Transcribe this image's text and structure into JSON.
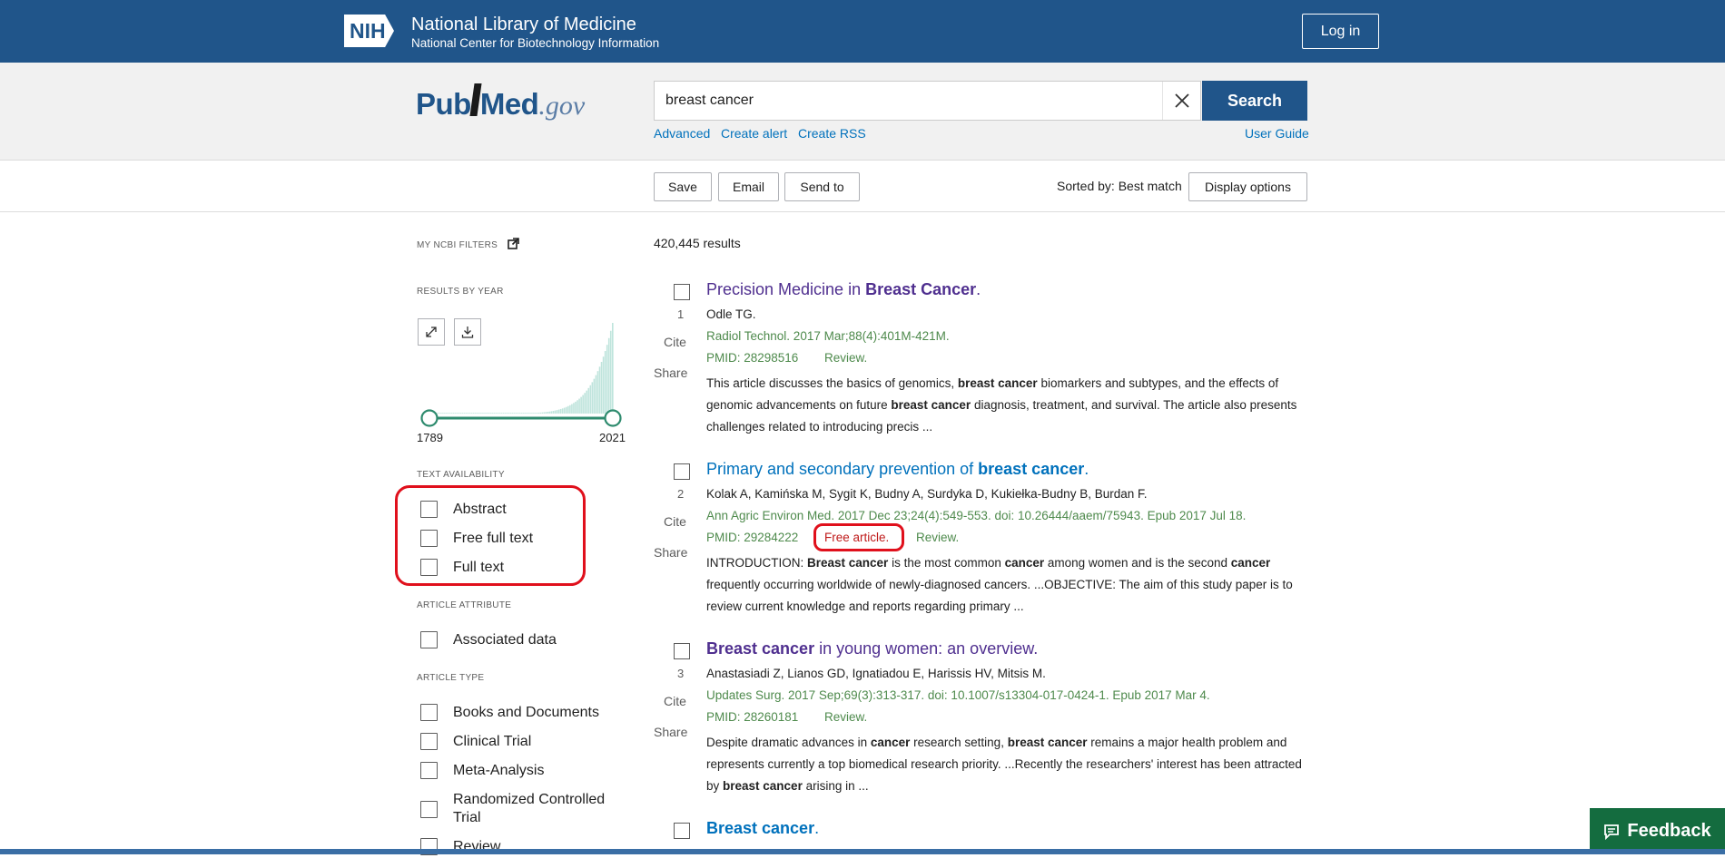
{
  "nih": {
    "logo_text": "NIH",
    "title": "National Library of Medicine",
    "subtitle": "National Center for Biotechnology Information",
    "login_label": "Log in"
  },
  "brand": {
    "pub": "Pub",
    "med": "Med",
    "gov": ".gov"
  },
  "search": {
    "value": "breast cancer",
    "button_label": "Search",
    "links": {
      "advanced": "Advanced",
      "create_alert": "Create alert",
      "create_rss": "Create RSS",
      "user_guide": "User Guide"
    }
  },
  "toolbar": {
    "save": "Save",
    "email": "Email",
    "send_to": "Send to",
    "sorted_by": "Sorted by: Best match",
    "display_options": "Display options"
  },
  "sidebar": {
    "my_filters": "MY NCBI FILTERS",
    "results_by_year": "RESULTS BY YEAR",
    "year_start": "1789",
    "year_end": "2021",
    "text_availability": {
      "heading": "TEXT AVAILABILITY",
      "items": [
        "Abstract",
        "Free full text",
        "Full text"
      ]
    },
    "article_attribute": {
      "heading": "ARTICLE ATTRIBUTE",
      "items": [
        "Associated data"
      ]
    },
    "article_type": {
      "heading": "ARTICLE TYPE",
      "items": [
        "Books and Documents",
        "Clinical Trial",
        "Meta-Analysis",
        "Randomized Controlled Trial",
        "Review"
      ]
    }
  },
  "results": {
    "count": "420,445 results",
    "cite_label": "Cite",
    "share_label": "Share",
    "items": [
      {
        "num": "1",
        "title_plain": "Precision Medicine in ",
        "title_bold": "Breast Cancer",
        "title_end": ".",
        "authors": "Odle TG.",
        "journal": "Radiol Technol. 2017 Mar;88(4):401M-421M.",
        "pmid": "PMID: 28298516",
        "review": "Review.",
        "snippet": [
          {
            "t": "This article discusses the basics of genomics, "
          },
          {
            "t": "breast cancer",
            "b": true
          },
          {
            "t": " biomarkers and subtypes, and the effects of genomic advancements on future "
          },
          {
            "t": "breast cancer",
            "b": true
          },
          {
            "t": " diagnosis, treatment, and survival. The article also presents challenges related to introducing precis ..."
          }
        ]
      },
      {
        "num": "2",
        "title_plain": "Primary and secondary prevention of ",
        "title_bold": "breast cancer",
        "title_end": ".",
        "authors": "Kolak A, Kamińska M, Sygit K, Budny A, Surdyka D, Kukiełka-Budny B, Burdan F.",
        "journal": "Ann Agric Environ Med. 2017 Dec 23;24(4):549-553. doi: 10.26444/aaem/75943. Epub 2017 Jul 18.",
        "pmid": "PMID: 29284222",
        "free": "Free article.",
        "review": "Review.",
        "snippet": [
          {
            "t": "INTRODUCTION: "
          },
          {
            "t": "Breast cancer",
            "b": true
          },
          {
            "t": " is the most common "
          },
          {
            "t": "cancer",
            "b": true
          },
          {
            "t": " among women and is the second "
          },
          {
            "t": "cancer",
            "b": true
          },
          {
            "t": " frequently occurring worldwide of newly-diagnosed cancers. ...OBJECTIVE: The aim of this study paper is to review current knowledge and reports regarding primary ..."
          }
        ]
      },
      {
        "num": "3",
        "title_bold": "Breast cancer",
        "title_plain": " in young women: an overview.",
        "title_end": "",
        "authors": "Anastasiadi Z, Lianos GD, Ignatiadou E, Harissis HV, Mitsis M.",
        "journal": "Updates Surg. 2017 Sep;69(3):313-317. doi: 10.1007/s13304-017-0424-1. Epub 2017 Mar 4.",
        "pmid": "PMID: 28260181",
        "review": "Review.",
        "snippet": [
          {
            "t": "Despite dramatic advances in "
          },
          {
            "t": "cancer",
            "b": true
          },
          {
            "t": " research setting, "
          },
          {
            "t": "breast cancer",
            "b": true
          },
          {
            "t": " remains a major health problem and represents currently a top biomedical research priority. ...Recently the researchers' interest has been attracted by "
          },
          {
            "t": "breast cancer",
            "b": true
          },
          {
            "t": " arising in ..."
          }
        ]
      },
      {
        "num": "4",
        "title_bold": "Breast cancer",
        "title_end": "."
      }
    ]
  },
  "feedback_label": "Feedback",
  "colors": {
    "header": "#20558a",
    "link": "#0071bc",
    "visited": "#4f2f8f",
    "journal": "#4e8a4c",
    "highlight": "#e0101c",
    "feedback": "#146c3f"
  }
}
